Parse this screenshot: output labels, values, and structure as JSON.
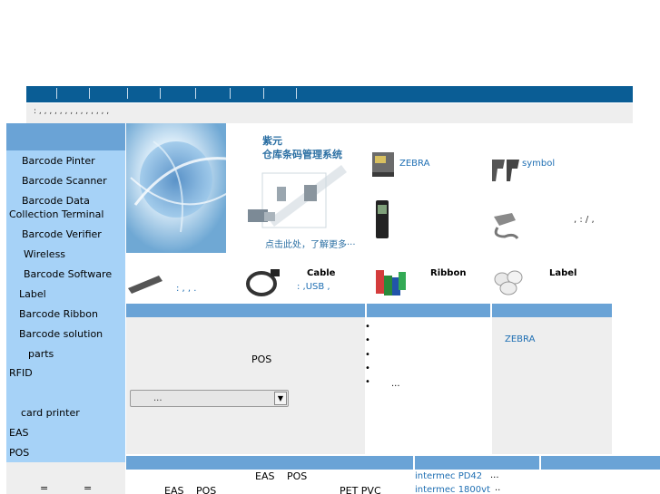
{
  "subbar": {
    "text": ":  ,   ,   ,   ,   ,   ,   ,   ,   , ,   ,   ,   ,   ,"
  },
  "sidebar": {
    "items": [
      "Barcode Pinter",
      "Barcode Scanner",
      "Barcode Data",
      "Collection Terminal",
      "Barcode Verifier",
      "Wireless",
      "Barcode Software",
      "Label",
      "Barcode Ribbon",
      "Barcode solution",
      "parts",
      "RFID",
      "card printer",
      "EAS",
      "POS"
    ],
    "bottom_eq1": "=",
    "bottom_eq2": "="
  },
  "banner": {
    "title1": "紫元",
    "title2": "仓库条码管理系统",
    "more": "点击此处，了解更多···"
  },
  "brands": {
    "zebra": "ZEBRA",
    "symbol": "symbol",
    "colon_text": ",  :  /  ,"
  },
  "products": {
    "item1_sub": ":   ,   ,  .",
    "cable_label": "Cable",
    "cable_sub": ":  ,USB  ,",
    "ribbon_label": "Ribbon",
    "label_label": "Label"
  },
  "middle": {
    "pos_text": "POS",
    "select_value": "...",
    "dots": [
      "•",
      "•",
      "•",
      "•",
      "•"
    ],
    "ellipsis": "...",
    "zebra_link": "ZEBRA"
  },
  "bottom": {
    "eas1": "EAS",
    "pos1": "POS",
    "eas2": "EAS",
    "pos2": "POS",
    "pet_pvc": "PET PVC",
    "intermec1": "intermec PD42",
    "intermec2": "intermec 1800vt",
    "ell1": "...",
    "ell2": ".."
  },
  "colors": {
    "nav": "#0a5d95",
    "sidebar": "#a6d2f7",
    "accent_bar": "#6aa3d6",
    "panel": "#eeeeee",
    "link": "#1f6fb3"
  }
}
